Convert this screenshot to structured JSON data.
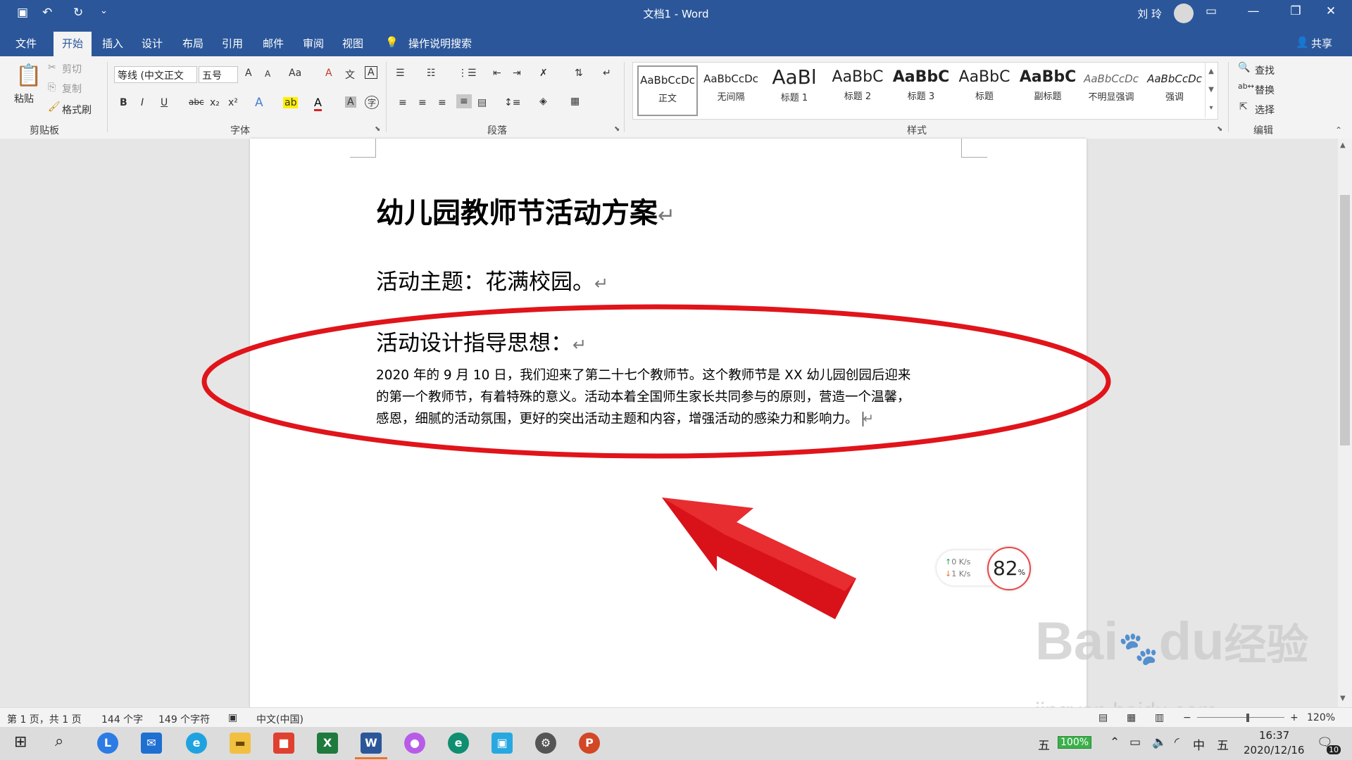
{
  "titlebar": {
    "title": "文档1 - Word",
    "user": "刘 玲",
    "qa_save": "▣",
    "qa_undo": "↶",
    "qa_redo": "↻",
    "qa_more": "⌄",
    "btn_opts": "▭",
    "btn_min": "—",
    "btn_max": "❐",
    "btn_close": "✕"
  },
  "tabs": {
    "items": [
      "文件",
      "开始",
      "插入",
      "设计",
      "布局",
      "引用",
      "邮件",
      "审阅",
      "视图"
    ],
    "active": "开始",
    "tellme": "操作说明搜索",
    "share": "共享"
  },
  "ribbon": {
    "clipboard": {
      "paste": "粘贴",
      "cut": "剪切",
      "copy": "复制",
      "format_painter": "格式刷",
      "label": "剪贴板"
    },
    "font": {
      "family": "等线 (中文正文",
      "size": "五号",
      "label": "字体",
      "grow": "A",
      "shrink": "A",
      "case": "Aa",
      "clear": "A",
      "phonetic": "文",
      "border": "A",
      "bold": "B",
      "italic": "I",
      "underline": "U",
      "strike": "abc",
      "sub": "x₂",
      "sup": "x²",
      "effects": "A",
      "highlight": "ab",
      "color": "A",
      "shade": "A",
      "enclose": "字"
    },
    "paragraph": {
      "label": "段落"
    },
    "styles": {
      "label": "样式",
      "items": [
        {
          "sample": "AaBbCcDc",
          "name": "正文"
        },
        {
          "sample": "AaBbCcDc",
          "name": "无间隔"
        },
        {
          "sample": "AaBl",
          "name": "标题 1"
        },
        {
          "sample": "AaBbC",
          "name": "标题 2"
        },
        {
          "sample": "AaBbC",
          "name": "标题 3"
        },
        {
          "sample": "AaBbC",
          "name": "标题"
        },
        {
          "sample": "AaBbC",
          "name": "副标题"
        },
        {
          "sample": "AaBbCcDc",
          "name": "不明显强调"
        },
        {
          "sample": "AaBbCcDc",
          "name": "强调"
        }
      ]
    },
    "editing": {
      "find": "查找",
      "replace": "替换",
      "select": "选择",
      "label": "编辑"
    }
  },
  "document": {
    "title": "幼儿园教师节活动方案",
    "theme": "活动主题：花满校园。",
    "guide_heading": "活动设计指导思想：",
    "para_line1": "2020 年的 9 月 10 日，我们迎来了第二十七个教师节。这个教师节是 XX 幼儿园创园后迎来",
    "para_line2": "的第一个教师节，有着特殊的意义。活动本着全国师生家长共同参与的原则，营造一个温馨，",
    "para_line3": "感恩，细腻的活动氛围，更好的突出活动主题和内容，增强活动的感染力和影响力。",
    "para_mark": "↵"
  },
  "net_widget": {
    "up": "0",
    "down": "1",
    "unit": "K/s",
    "cpu": "82",
    "cpu_unit": "%"
  },
  "watermark": {
    "brand": "Bai",
    "brand2": "du",
    "cn": "经验",
    "url": "jingyan.baidu.com"
  },
  "status": {
    "page": "第 1 页，共 1 页",
    "words": "144 个字",
    "chars": "149 个字符",
    "lang": "中文(中国)",
    "zoom": "120%"
  },
  "taskbar": {
    "time": "16:37",
    "date": "2020/12/16",
    "ime1": "五",
    "battery": "100%",
    "lang": "中",
    "ime2": "五",
    "notif": "10"
  },
  "colors": {
    "accent": "#2b579a",
    "annotation": "#e0141a"
  }
}
